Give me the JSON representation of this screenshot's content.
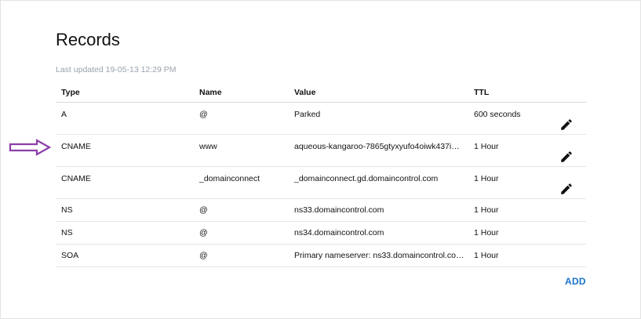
{
  "section": {
    "title": "Records",
    "last_updated": "Last updated 19-05-13 12:29 PM"
  },
  "table": {
    "headers": [
      "Type",
      "Name",
      "Value",
      "TTL"
    ],
    "rows": [
      {
        "type": "A",
        "name": "@",
        "value": "Parked",
        "ttl": "600 seconds",
        "editable": true
      },
      {
        "type": "CNAME",
        "name": "www",
        "value": "aqueous-kangaroo-7865gtyxyufo4oiwk437i…",
        "ttl": "1 Hour",
        "editable": true
      },
      {
        "type": "CNAME",
        "name": "_domainconnect",
        "value": "_domainconnect.gd.domaincontrol.com",
        "ttl": "1 Hour",
        "editable": true
      },
      {
        "type": "NS",
        "name": "@",
        "value": "ns33.domaincontrol.com",
        "ttl": "1 Hour",
        "editable": false
      },
      {
        "type": "NS",
        "name": "@",
        "value": "ns34.domaincontrol.com",
        "ttl": "1 Hour",
        "editable": false
      },
      {
        "type": "SOA",
        "name": "@",
        "value": "Primary nameserver: ns33.domaincontrol.co…",
        "ttl": "1 Hour",
        "editable": false
      }
    ]
  },
  "actions": {
    "add_label": "ADD"
  },
  "icons": {
    "edit": "pencil-icon",
    "annotation": "arrow-right-icon"
  },
  "colors": {
    "accent": "#1a73c8",
    "annotation_arrow": "#8b3fa8",
    "muted_text": "#9aa3ad"
  }
}
